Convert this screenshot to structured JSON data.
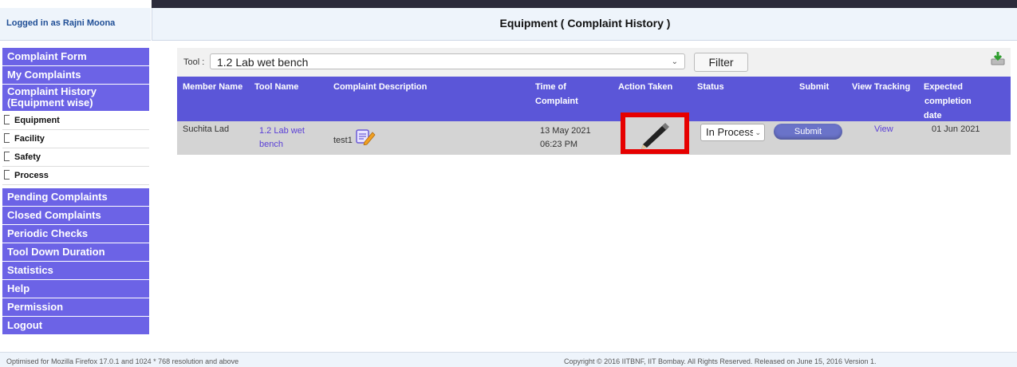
{
  "header": {
    "logged_in": "Logged in as Rajni Moona",
    "page_title": "Equipment ( Complaint History )"
  },
  "sidebar": {
    "top_items": [
      "Complaint Form",
      "My Complaints"
    ],
    "history_item": [
      "Complaint History",
      "(Equipment wise)"
    ],
    "sub_items": [
      "Equipment",
      "Facility",
      "Safety",
      "Process"
    ],
    "bottom_items": [
      "Pending Complaints",
      "Closed Complaints",
      "Periodic Checks",
      "Tool Down Duration",
      "Statistics",
      "Help",
      "Permission",
      "Logout"
    ]
  },
  "filter": {
    "tool_label": "Tool :",
    "tool_value": "1.2 Lab wet bench",
    "filter_button": "Filter"
  },
  "table": {
    "headers": {
      "member_name": "Member Name",
      "tool_name": "Tool Name",
      "complaint_description": "Complaint Description",
      "time_of_complaint": [
        "Time of",
        "Complaint"
      ],
      "action_taken": "Action Taken",
      "status": "Status",
      "submit": "Submit",
      "view_tracking": "View Tracking",
      "expected_completion": [
        "Expected",
        "completion",
        "date"
      ]
    },
    "rows": [
      {
        "member_name": "Suchita Lad",
        "tool_name": [
          "1.2 Lab wet",
          "bench"
        ],
        "description": "test1",
        "time": [
          "13 May 2021",
          "06:23 PM"
        ],
        "status": "In Process",
        "submit": "Submit",
        "view": "View",
        "expected_date": "01 Jun 2021"
      }
    ]
  },
  "footer": {
    "left": "Optimised for Mozilla Firefox 17.0.1 and 1024 * 768 resolution and above",
    "right": "Copyright © 2016 IITBNF, IIT Bombay. All Rights Reserved. Released on June 15, 2016 Version 1."
  },
  "colors": {
    "nav_bg": "#6c63e6",
    "table_header_bg": "#5b56d8",
    "highlight_border": "#e60000"
  }
}
